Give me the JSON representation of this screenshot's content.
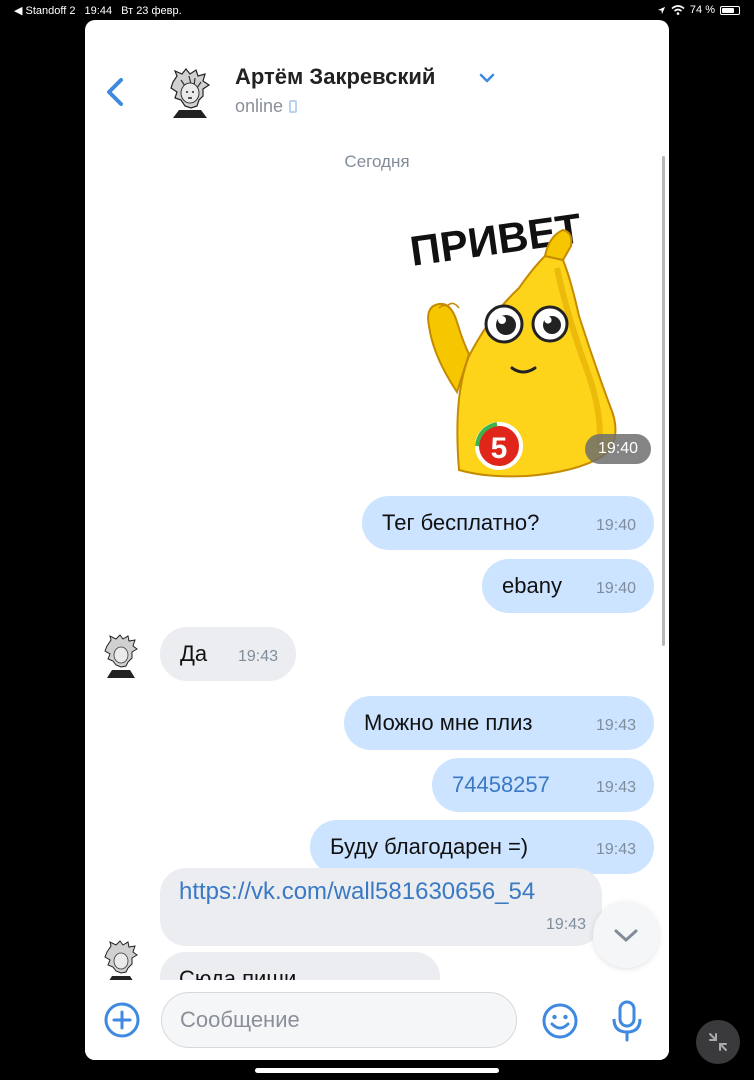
{
  "status_bar": {
    "back_app": "◀ Standoff 2",
    "time": "19:44",
    "date": "Вт 23 февр.",
    "battery_percent": "74 %",
    "battery_level": 0.74
  },
  "header": {
    "contact_name": "Артём Закревский",
    "status": "online"
  },
  "chat": {
    "date_separator": "Сегодня",
    "sticker": {
      "caption": "ПРИВЕТ",
      "badge": "5",
      "time": "19:40"
    },
    "messages": [
      {
        "text": "Тег бесплатно?",
        "time": "19:40"
      },
      {
        "text": "ebany",
        "time": "19:40"
      },
      {
        "text": "Да",
        "time": "19:43"
      },
      {
        "text": "Можно мне плиз",
        "time": "19:43"
      },
      {
        "text": "74458257",
        "time": "19:43"
      },
      {
        "text": "Буду благодарен =)",
        "time": "19:43"
      },
      {
        "text": "https://vk.com/wall581630656_54",
        "time": "19:43"
      },
      {
        "text": "Сюда пиши"
      }
    ]
  },
  "composer": {
    "placeholder": "Сообщение"
  },
  "colors": {
    "accent": "#3f8ae0",
    "outgoing_bubble": "#cce4ff",
    "incoming_bubble": "#ebedf0",
    "link": "#3a79c4"
  },
  "icons": [
    "back-chevron-icon",
    "dropdown-chevron-icon",
    "phone-icon",
    "add-icon",
    "emoji-icon",
    "microphone-icon",
    "scroll-down-icon",
    "collapse-icon",
    "wifi-icon",
    "location-icon",
    "battery-icon"
  ]
}
